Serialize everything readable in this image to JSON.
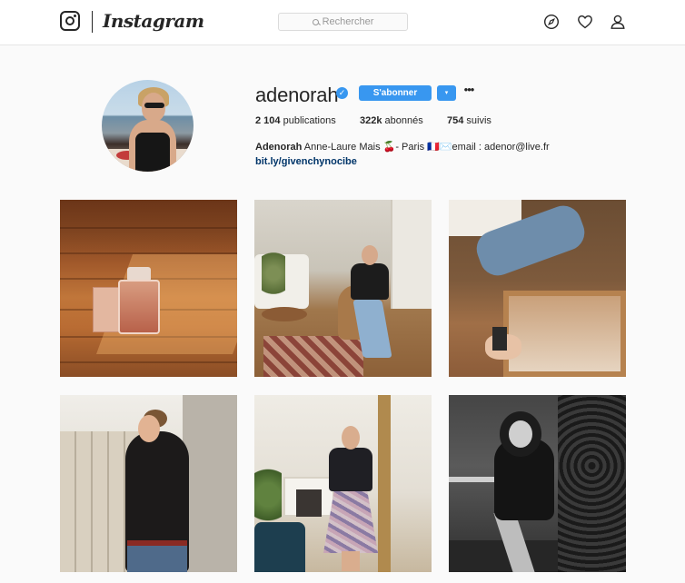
{
  "header": {
    "wordmark": "Instagram",
    "search_placeholder": "Rechercher",
    "icons": [
      "instagram-camera-icon",
      "search-icon",
      "compass-icon",
      "heart-icon",
      "user-icon"
    ]
  },
  "profile": {
    "username": "adenorah",
    "verified_mark": "✓",
    "follow_label": "S'abonner",
    "dropdown_glyph": "▾",
    "more_glyph": "•••",
    "stats": {
      "posts_value": "2 104",
      "posts_label": "publications",
      "followers_value": "322k",
      "followers_label": "abonnés",
      "following_value": "754",
      "following_label": "suivis"
    },
    "bio": {
      "name": "Adenorah",
      "text": "Anne-Laure Mais 🍒- Paris 🇫🇷✉️email : adenor@live.fr",
      "link": "bit.ly/givenchynocibe"
    }
  },
  "posts": [
    {
      "subject": "perfume-bottle-on-wood-floor"
    },
    {
      "subject": "woman-seated-in-living-room"
    },
    {
      "subject": "legs-and-mirror-with-perfume"
    },
    {
      "subject": "woman-on-balcony"
    },
    {
      "subject": "mirror-selfie-in-pleated-skirt"
    },
    {
      "subject": "black-and-white-portrait-smoking"
    }
  ],
  "colors": {
    "accent": "#3897f0",
    "text": "#262626",
    "link": "#003569",
    "page_bg": "#fafafa",
    "border": "#dbdbdb"
  }
}
